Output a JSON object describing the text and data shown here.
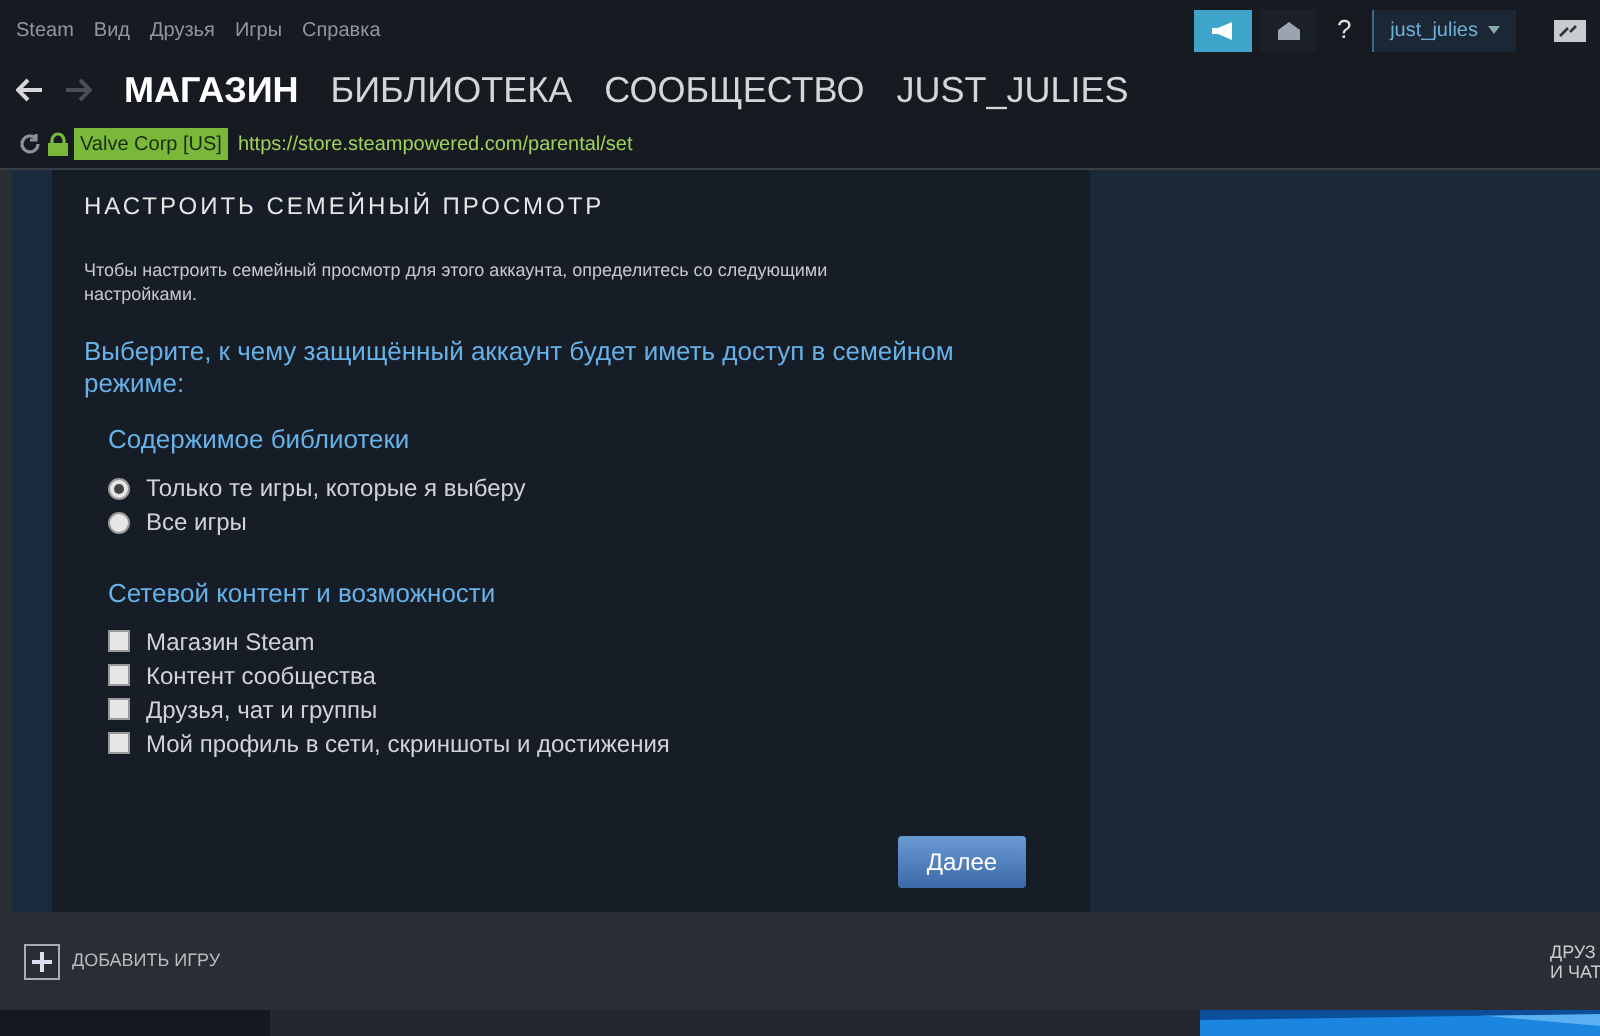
{
  "menu": [
    "Steam",
    "Вид",
    "Друзья",
    "Игры",
    "Справка"
  ],
  "account": {
    "username": "just_julies",
    "help": "?"
  },
  "nav": {
    "tabs": [
      {
        "label": "МАГАЗИН",
        "selected": true
      },
      {
        "label": "БИБЛИОТЕКА",
        "selected": false
      },
      {
        "label": "СООБЩЕСТВО",
        "selected": false
      },
      {
        "label": "JUST_JULIES",
        "selected": false
      }
    ]
  },
  "address": {
    "certificate": "Valve Corp [US]",
    "url": "https://store.steampowered.com/parental/set"
  },
  "panel": {
    "title": "НАСТРОИТЬ СЕМЕЙНЫЙ ПРОСМОТР",
    "intro": "Чтобы настроить семейный просмотр для этого аккаунта, определитесь со следующими настройками.",
    "question": "Выберите, к чему защищённый аккаунт будет иметь доступ в семейном режиме:",
    "sections": [
      {
        "heading": "Содержимое библиотеки",
        "options": [
          {
            "kind": "radio",
            "label": "Только те игры, которые я выберу",
            "selected": true
          },
          {
            "kind": "radio",
            "label": "Все игры",
            "selected": false
          }
        ]
      },
      {
        "heading": "Сетевой контент и возможности",
        "options": [
          {
            "kind": "checkbox",
            "label": "Магазин Steam",
            "checked": false
          },
          {
            "kind": "checkbox",
            "label": "Контент сообщества",
            "checked": false
          },
          {
            "kind": "checkbox",
            "label": "Друзья, чат и группы",
            "checked": false
          },
          {
            "kind": "checkbox",
            "label": "Мой профиль в сети, скриншоты и достижения",
            "checked": false
          }
        ]
      }
    ],
    "next_button": "Далее"
  },
  "bottom_bar": {
    "add_game": "ДОБАВИТЬ ИГРУ",
    "friends_line1": "ДРУЗ",
    "friends_line2": "И ЧАТ"
  }
}
